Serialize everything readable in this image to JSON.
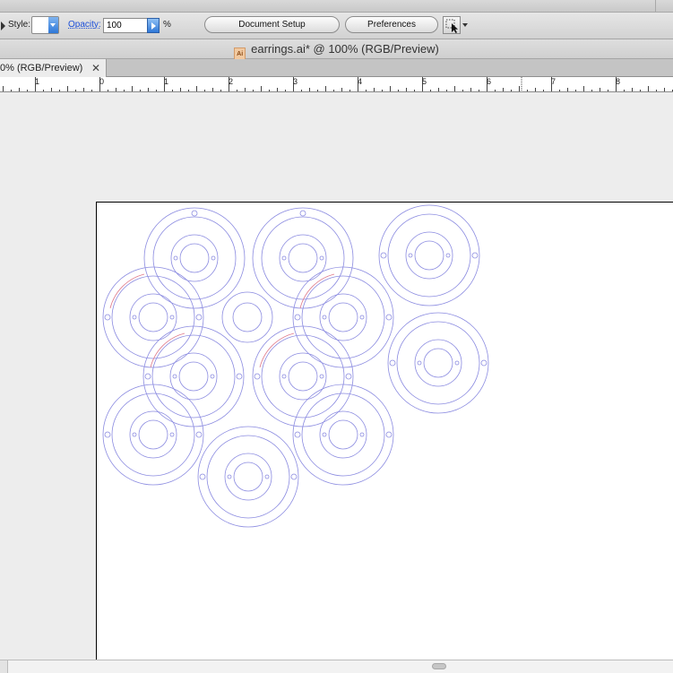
{
  "control_bar": {
    "style_label": "Style:",
    "opacity_label": "Opacity:",
    "opacity_value": "100",
    "percent_sign": "%",
    "document_setup_label": "Document Setup",
    "preferences_label": "Preferences",
    "tool_icon": "selection-tool-icon"
  },
  "document": {
    "title": "earrings.ai* @ 100% (RGB/Preview)",
    "file_icon": "illustrator-file-icon"
  },
  "tab": {
    "label": "0% (RGB/Preview)",
    "close_glyph": "✕"
  },
  "ruler": {
    "labels": [
      "1",
      "0",
      "1",
      "2",
      "3",
      "4",
      "5",
      "6",
      "7",
      "8"
    ]
  },
  "colors": {
    "outline_blue": "#8a8ae0",
    "overlap_red": "#e07a8a",
    "accent_blue": "#2f78d8"
  }
}
